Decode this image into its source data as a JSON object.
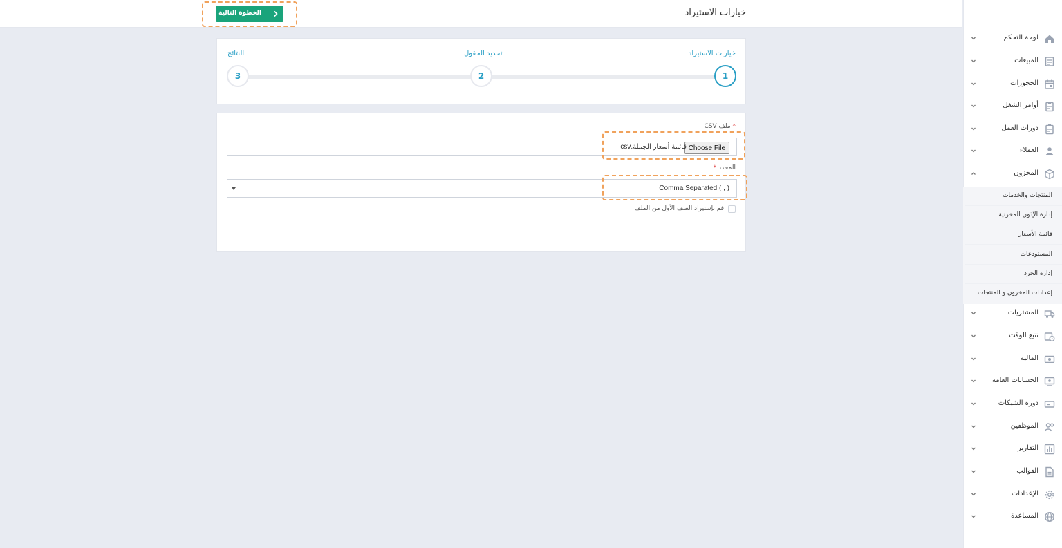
{
  "header": {
    "title": "خيارات الاستيراد",
    "next_button": "الخطوة التالية"
  },
  "stepper": {
    "steps": [
      {
        "number": "1",
        "label": "خيارات الاستيراد"
      },
      {
        "number": "2",
        "label": "تحديد الحقول"
      },
      {
        "number": "3",
        "label": "النتائج"
      }
    ]
  },
  "form": {
    "csv_label": "ملف CSV",
    "required_mark": "*",
    "choose_file": "Choose File",
    "file_name": "قائمة أسعار الجملة.csv",
    "delimiter_label": "المحدد",
    "delimiter_value": "Comma Separated ( , )",
    "first_row_label": "قم بإستيراد الصف الأول من الملف"
  },
  "sidebar": {
    "items": [
      {
        "label": "لوحة التحكم",
        "icon": "home-icon"
      },
      {
        "label": "المبيعات",
        "icon": "sales-icon"
      },
      {
        "label": "الحجوزات",
        "icon": "calendar-icon"
      },
      {
        "label": "أوامر الشغل",
        "icon": "clipboard-icon"
      },
      {
        "label": "دورات العمل",
        "icon": "clipboard-icon"
      },
      {
        "label": "العملاء",
        "icon": "user-icon"
      },
      {
        "label": "المخزون",
        "icon": "box-icon"
      }
    ],
    "subitems": [
      "المنتجات والخدمات",
      "إدارة الإذون المخزنية",
      "قائمة الأسعار",
      "المستودعات",
      "إدارة الجرد",
      "إعدادات المخزون و المنتجات"
    ],
    "items_after": [
      {
        "label": "المشتريات",
        "icon": "truck-icon"
      },
      {
        "label": "تتبع الوقت",
        "icon": "clock-calendar-icon"
      },
      {
        "label": "المالية",
        "icon": "money-icon"
      },
      {
        "label": "الحسابات العامة",
        "icon": "ledger-icon"
      },
      {
        "label": "دورة الشيكات",
        "icon": "cheque-icon"
      },
      {
        "label": "الموظفين",
        "icon": "users-icon"
      },
      {
        "label": "التقارير",
        "icon": "chart-icon"
      },
      {
        "label": "القوالب",
        "icon": "document-icon"
      },
      {
        "label": "الإعدادات",
        "icon": "gear-icon"
      },
      {
        "label": "المساعدة",
        "icon": "globe-icon"
      }
    ]
  },
  "colors": {
    "accent": "#2a9fc5",
    "primary_button": "#1aa47b",
    "highlight": "#f0a25c",
    "background": "#e8ebf2"
  }
}
